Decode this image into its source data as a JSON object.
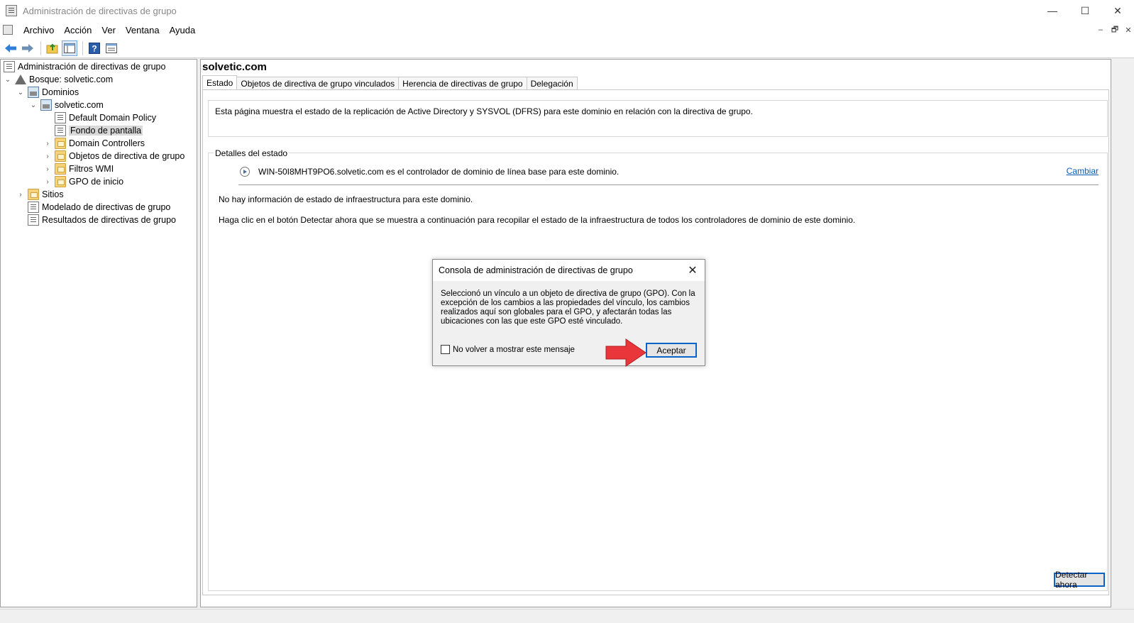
{
  "window": {
    "title": "Administración de directivas de grupo",
    "controls": {
      "minimize": "—",
      "maximize": "☐",
      "close": "✕"
    }
  },
  "menu": {
    "items": [
      "Archivo",
      "Acción",
      "Ver",
      "Ventana",
      "Ayuda"
    ],
    "mdi_controls": {
      "minimize": "–",
      "restore": "🗗",
      "close": "✕"
    }
  },
  "toolbar": {
    "icons": [
      "back-arrow-icon",
      "forward-arrow-icon",
      "up-folder-icon",
      "show-hide-tree-icon",
      "help-icon",
      "properties-icon"
    ]
  },
  "tree": {
    "root": "Administración de directivas de grupo",
    "forest": "Bosque: solvetic.com",
    "domains": "Dominios",
    "domain": "solvetic.com",
    "items": [
      "Default Domain Policy",
      "Fondo de pantalla",
      "Domain Controllers",
      "Objetos de directiva de grupo",
      "Filtros WMI",
      "GPO de inicio"
    ],
    "sites": "Sitios",
    "modeling": "Modelado de directivas de grupo",
    "results": "Resultados de directivas de grupo"
  },
  "content": {
    "title": "solvetic.com",
    "tabs": [
      "Estado",
      "Objetos de directiva de grupo vinculados",
      "Herencia de directivas de grupo",
      "Delegación"
    ],
    "active_tab": "Estado",
    "info": "Esta página muestra el estado de la replicación de Active Directory y SYSVOL (DFRS) para este dominio en relación con la directiva de grupo.",
    "status_legend": "Detalles del estado",
    "dc_line": "WIN-50I8MHT9PO6.solvetic.com es el controlador de dominio de línea base para este dominio.",
    "change_link": "Cambiar",
    "no_info": "No hay información de estado de infraestructura para este dominio.",
    "instructions": "Haga clic en el botón Detectar ahora que se muestra a continuación para recopilar el estado de la infraestructura de todos los controladores de dominio de este dominio.",
    "detect_button": "Detectar ahora"
  },
  "dialog": {
    "title": "Consola de administración de directivas de grupo",
    "message": "Seleccionó un vínculo a un objeto de directiva de grupo (GPO). Con la excepción de los cambios a las propiedades del vínculo, los cambios realizados aquí son globales para el GPO, y afectarán todas las ubicaciones con las que este GPO esté vinculado.",
    "checkbox_label": "No volver a mostrar este mensaje",
    "checkbox_checked": false,
    "ok_button": "Aceptar",
    "close_glyph": "✕"
  },
  "colors": {
    "accent_blue": "#0a64c8",
    "link": "#0b5ab3",
    "arrow_red": "#e8363a"
  }
}
